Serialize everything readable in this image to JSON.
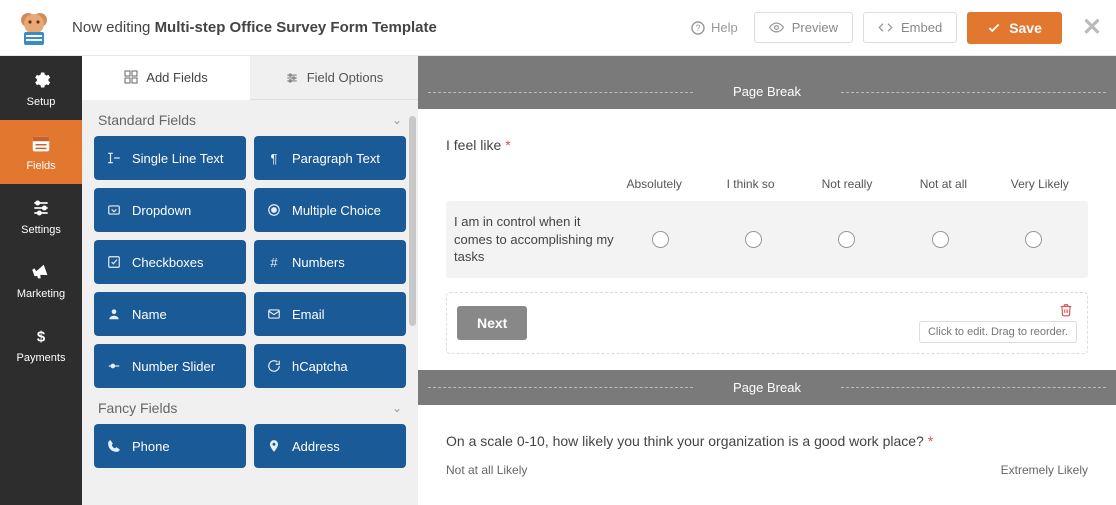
{
  "header": {
    "prefix": "Now editing",
    "title": "Multi-step Office Survey Form Template",
    "help": "Help",
    "preview": "Preview",
    "embed": "Embed",
    "save": "Save"
  },
  "rail": {
    "items": [
      {
        "label": "Setup",
        "icon": "gear-icon"
      },
      {
        "label": "Fields",
        "icon": "form-icon",
        "active": true
      },
      {
        "label": "Settings",
        "icon": "sliders-icon"
      },
      {
        "label": "Marketing",
        "icon": "bullhorn-icon"
      },
      {
        "label": "Payments",
        "icon": "dollar-icon"
      }
    ]
  },
  "panel": {
    "tabs": {
      "add": "Add Fields",
      "options": "Field Options"
    },
    "standard": {
      "title": "Standard Fields",
      "items": [
        {
          "label": "Single Line Text",
          "icon": "text-icon"
        },
        {
          "label": "Paragraph Text",
          "icon": "paragraph-icon"
        },
        {
          "label": "Dropdown",
          "icon": "dropdown-icon"
        },
        {
          "label": "Multiple Choice",
          "icon": "radio-icon"
        },
        {
          "label": "Checkboxes",
          "icon": "check-icon"
        },
        {
          "label": "Numbers",
          "icon": "hash-icon"
        },
        {
          "label": "Name",
          "icon": "user-icon"
        },
        {
          "label": "Email",
          "icon": "envelope-icon"
        },
        {
          "label": "Number Slider",
          "icon": "slider-icon"
        },
        {
          "label": "hCaptcha",
          "icon": "captcha-icon"
        }
      ]
    },
    "fancy": {
      "title": "Fancy Fields",
      "items": [
        {
          "label": "Phone",
          "icon": "phone-icon"
        },
        {
          "label": "Address",
          "icon": "pin-icon"
        }
      ]
    }
  },
  "canvas": {
    "page_break": "Page Break",
    "likert_q": {
      "label": "I feel like",
      "columns": [
        "Absolutely",
        "I think so",
        "Not really",
        "Not at all",
        "Very Likely"
      ],
      "row_text": "I am in control when it comes to accomplishing my tasks"
    },
    "next_label": "Next",
    "hint": "Click to edit. Drag to reorder.",
    "scale_q": {
      "label": "On a scale 0-10, how likely you think your organization is a good work place?",
      "low": "Not at all Likely",
      "high": "Extremely Likely"
    }
  }
}
